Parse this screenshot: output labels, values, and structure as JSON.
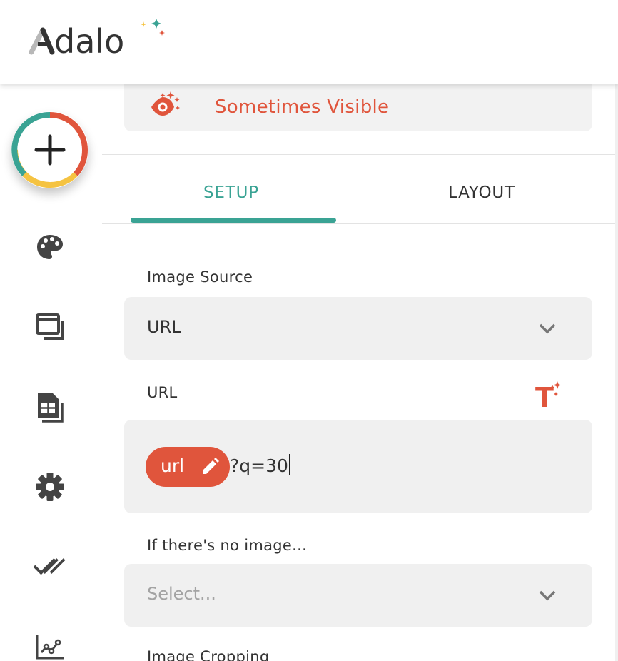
{
  "header": {
    "logo_text": "Adalo",
    "colors": {
      "logo_text": "#333333",
      "sparkle_teal": "#3aa394",
      "sparkle_orange": "#e0553c",
      "sparkle_yellow": "#f5c342"
    }
  },
  "sidebar": {
    "add_button_icon": "plus-icon",
    "items": [
      {
        "icon": "palette-icon"
      },
      {
        "icon": "screens-icon"
      },
      {
        "icon": "database-icon"
      },
      {
        "icon": "gear-icon"
      },
      {
        "icon": "double-check-icon"
      },
      {
        "icon": "analytics-icon"
      }
    ]
  },
  "panel": {
    "visibility": {
      "icon": "sparkle-eye-icon",
      "label": "Sometimes Visible"
    },
    "tabs": [
      {
        "label": "SETUP",
        "active": true
      },
      {
        "label": "LAYOUT",
        "active": false
      }
    ],
    "fields": {
      "image_source": {
        "label": "Image Source",
        "value": "URL"
      },
      "url": {
        "label": "URL",
        "magic_text_icon": "magic-text-icon",
        "chip_label": "url",
        "suffix": "?q=30"
      },
      "no_image": {
        "label": "If there's no image...",
        "placeholder": "Select..."
      },
      "cropping": {
        "label": "Image Cropping"
      }
    }
  },
  "colors": {
    "accent_teal": "#3aa394",
    "accent_orange": "#e0553c",
    "field_bg": "#f0f0f0"
  }
}
